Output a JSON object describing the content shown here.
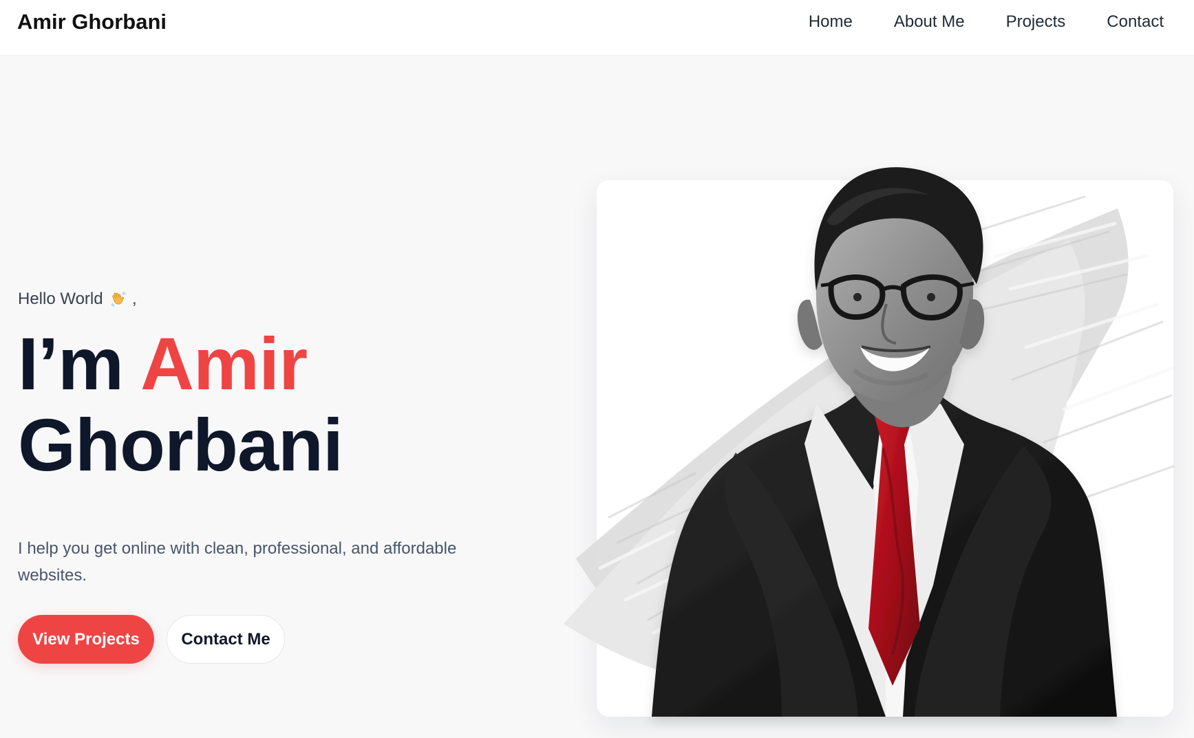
{
  "header": {
    "brand": "Amir Ghorbani",
    "nav": [
      {
        "label": "Home"
      },
      {
        "label": "About Me"
      },
      {
        "label": "Projects"
      },
      {
        "label": "Contact"
      }
    ]
  },
  "hero": {
    "greeting": "Hello World",
    "greeting_suffix": ",",
    "wave_icon": "waving-hand-icon",
    "headline_prefix": "I’m",
    "headline_accent": "Amir",
    "headline_second_line": "Ghorbani",
    "subtitle": "I help you get online with clean, professional, and affordable websites.",
    "buttons": {
      "primary": "View Projects",
      "secondary": "Contact Me"
    }
  },
  "colors": {
    "accent": "#ef4444",
    "heading": "#0f172a",
    "body_text": "#475569",
    "background": "#f8f8f9"
  }
}
